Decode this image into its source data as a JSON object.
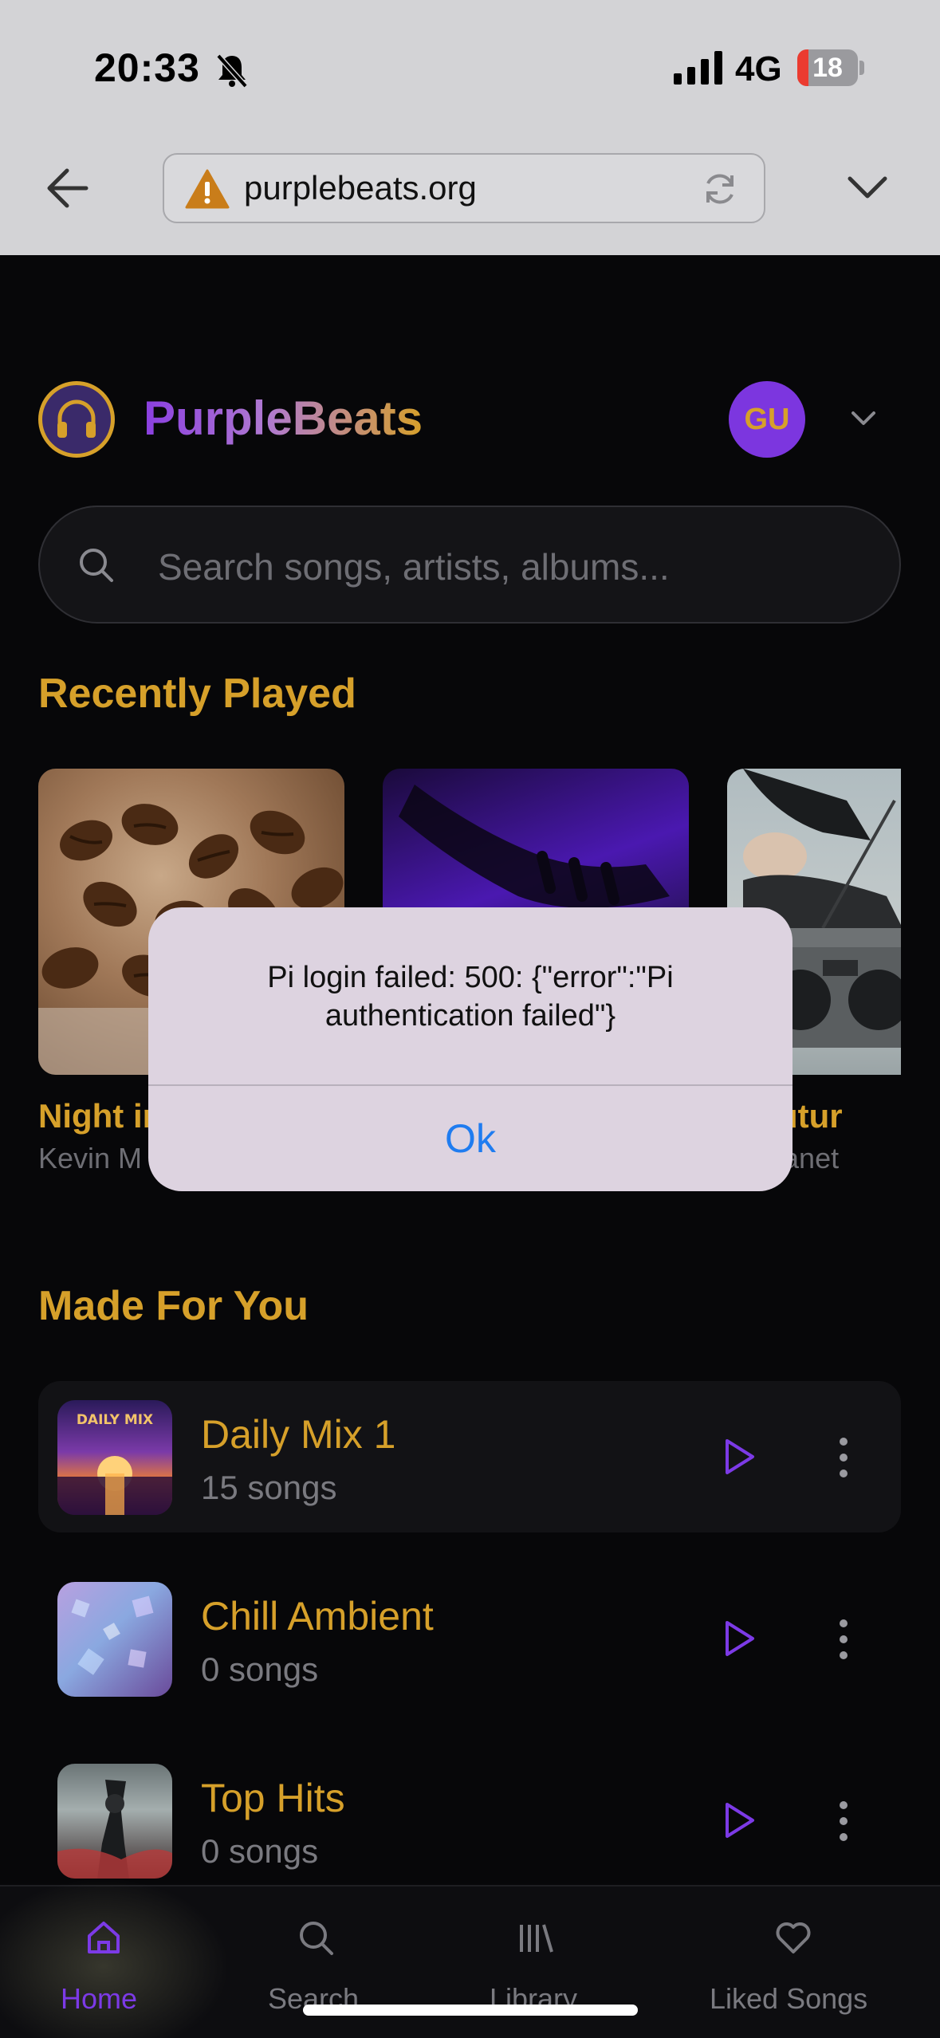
{
  "status_bar": {
    "time": "20:33",
    "network": "4G",
    "battery": "18",
    "battery_level": 0.18
  },
  "browser": {
    "url": "purplebeats.org"
  },
  "app": {
    "brand": "PurpleBeats",
    "avatar_initials": "GU",
    "search_placeholder": "Search songs, artists, albums...",
    "colors": {
      "accent": "#d6a02a",
      "primary": "#7c36df",
      "background": "#070709"
    }
  },
  "recently_played": {
    "title": "Recently Played",
    "items": [
      {
        "title": "Night ir",
        "artist": "Kevin M"
      },
      {
        "title": "",
        "artist": ""
      },
      {
        "title": "o Futur",
        "artist": "le Planet"
      }
    ]
  },
  "alert": {
    "message": "Pi login failed: 500: {\"error\":\"Pi authentication failed\"}",
    "ok_label": "Ok"
  },
  "made_for_you": {
    "title": "Made For You",
    "items": [
      {
        "title": "Daily Mix 1",
        "subtitle": "15 songs",
        "art_text": "DAILY MIX"
      },
      {
        "title": "Chill Ambient",
        "subtitle": "0 songs"
      },
      {
        "title": "Top Hits",
        "subtitle": "0 songs"
      }
    ]
  },
  "bottom_nav": {
    "items": [
      {
        "label": "Home",
        "icon": "home-icon",
        "active": true
      },
      {
        "label": "Search",
        "icon": "search-icon",
        "active": false
      },
      {
        "label": "Library",
        "icon": "library-icon",
        "active": false
      },
      {
        "label": "Liked Songs",
        "icon": "heart-icon",
        "active": false
      }
    ]
  }
}
